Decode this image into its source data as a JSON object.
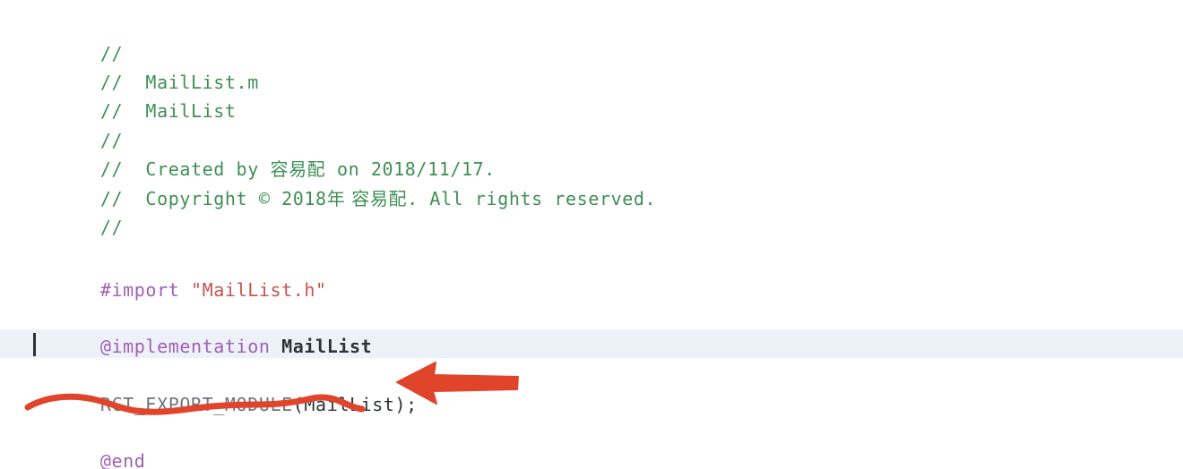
{
  "window": {
    "file_name": "MailList.m",
    "language": "Objective-C"
  },
  "editor": {
    "highlight_color": "#edf2f9",
    "background_color": "#ffffff",
    "caret_line_index": 11,
    "colors": {
      "comment": "#3f8f55",
      "preprocessor": "#a05fb4",
      "string": "#c9534f",
      "keyword": "#a05fb4",
      "type": "#2e3338",
      "macro": "#70757c",
      "plain": "#2e3338"
    }
  },
  "code": {
    "line_01": "//",
    "line_02_comment": "//  MailList.m",
    "line_03_comment": "//  MailList",
    "line_04_comment": "//",
    "line_05_comment": "//  Created by ",
    "line_05_author": "容易配",
    "line_05_tail": " on 2018/11/17.",
    "line_06_comment": "//  Copyright © 2018",
    "line_06_year_cjk": "年",
    "line_06_author": " 容易配",
    "line_06_tail": ". All rights reserved.",
    "line_07_comment": "//",
    "import_directive": "#import ",
    "import_string": "\"MailList.h\"",
    "implementation_keyword": "@implementation ",
    "implementation_class": "MailList",
    "macro_name": "RCT_EXPORT_MODULE",
    "macro_args": "(MailList);",
    "end_keyword": "@end"
  },
  "annotations": {
    "color": "#e0442b",
    "arrow_label": "red-arrow-pointing-at-macro-line",
    "underline_label": "red-wavy-underline-under-macro-line"
  }
}
